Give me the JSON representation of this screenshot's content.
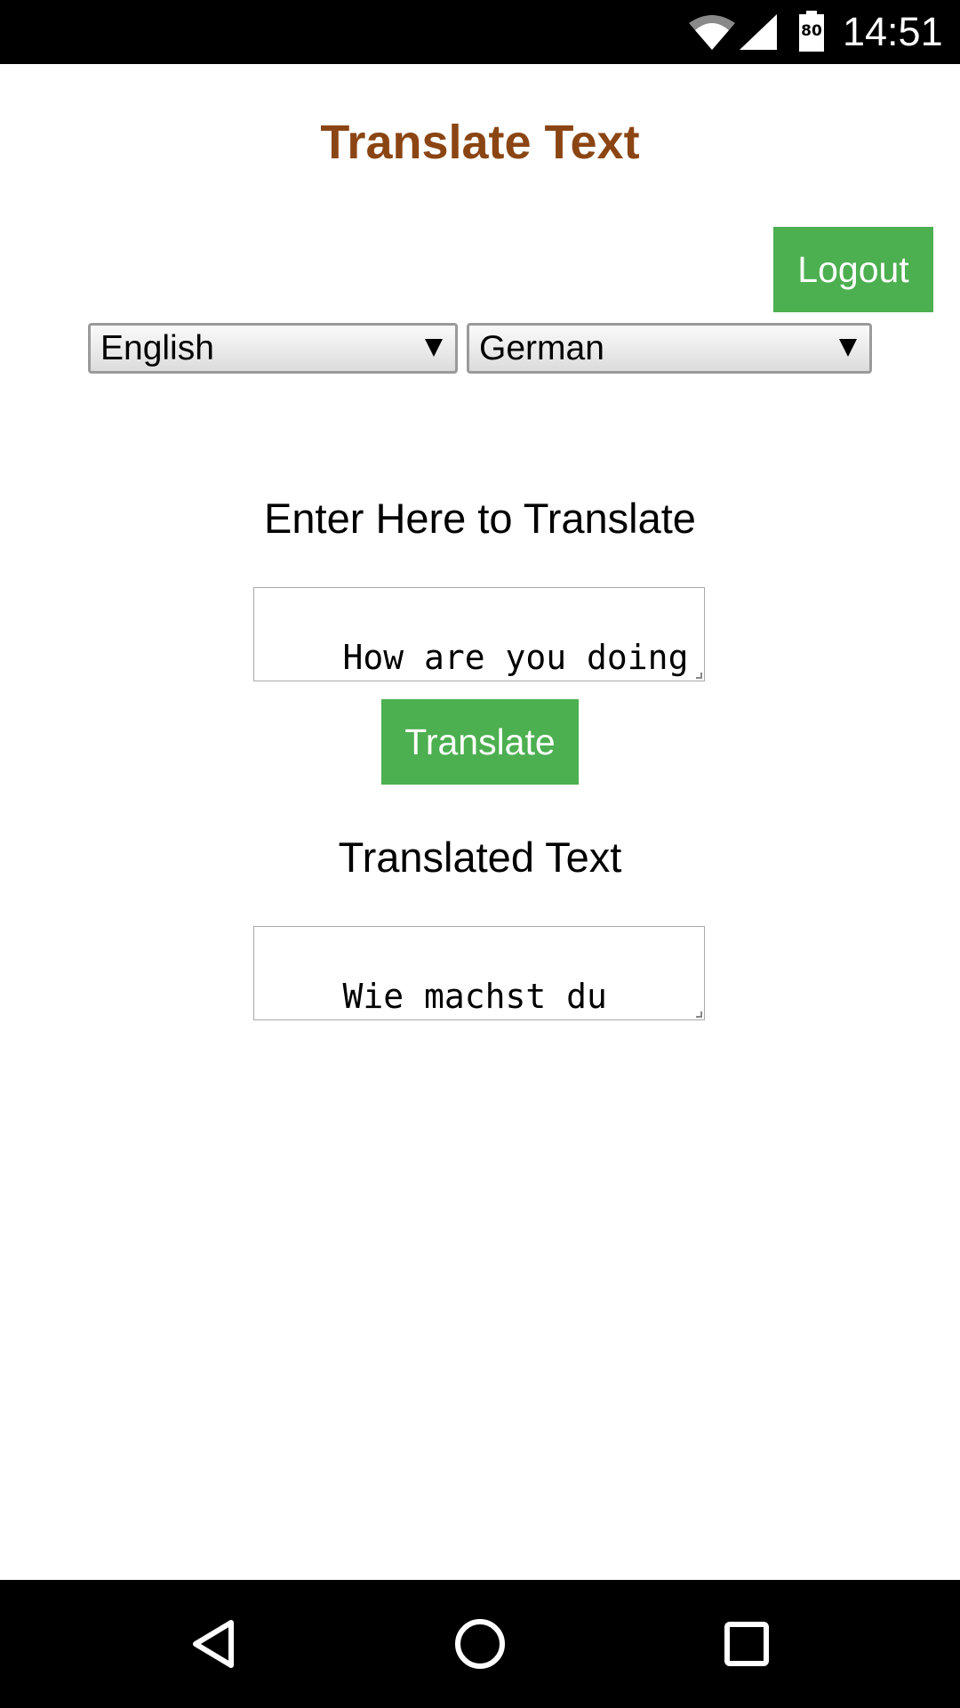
{
  "status_bar": {
    "time": "14:51",
    "battery_level": "80",
    "icons": [
      "wifi-icon",
      "cell-signal-icon",
      "battery-icon"
    ]
  },
  "page": {
    "title": "Translate Text",
    "logout_label": "Logout"
  },
  "languages": {
    "source_selected": "English",
    "target_selected": "German"
  },
  "input": {
    "label": "Enter Here to Translate",
    "value": "How are you doing"
  },
  "translate_label": "Translate",
  "output": {
    "label": "Translated Text",
    "value": "Wie machst du"
  },
  "nav_bar": {
    "icons": [
      "back-icon",
      "home-icon",
      "recents-icon"
    ]
  },
  "colors": {
    "title": "#8b4513",
    "button_bg": "#4caf50",
    "button_text": "#ffffff"
  }
}
